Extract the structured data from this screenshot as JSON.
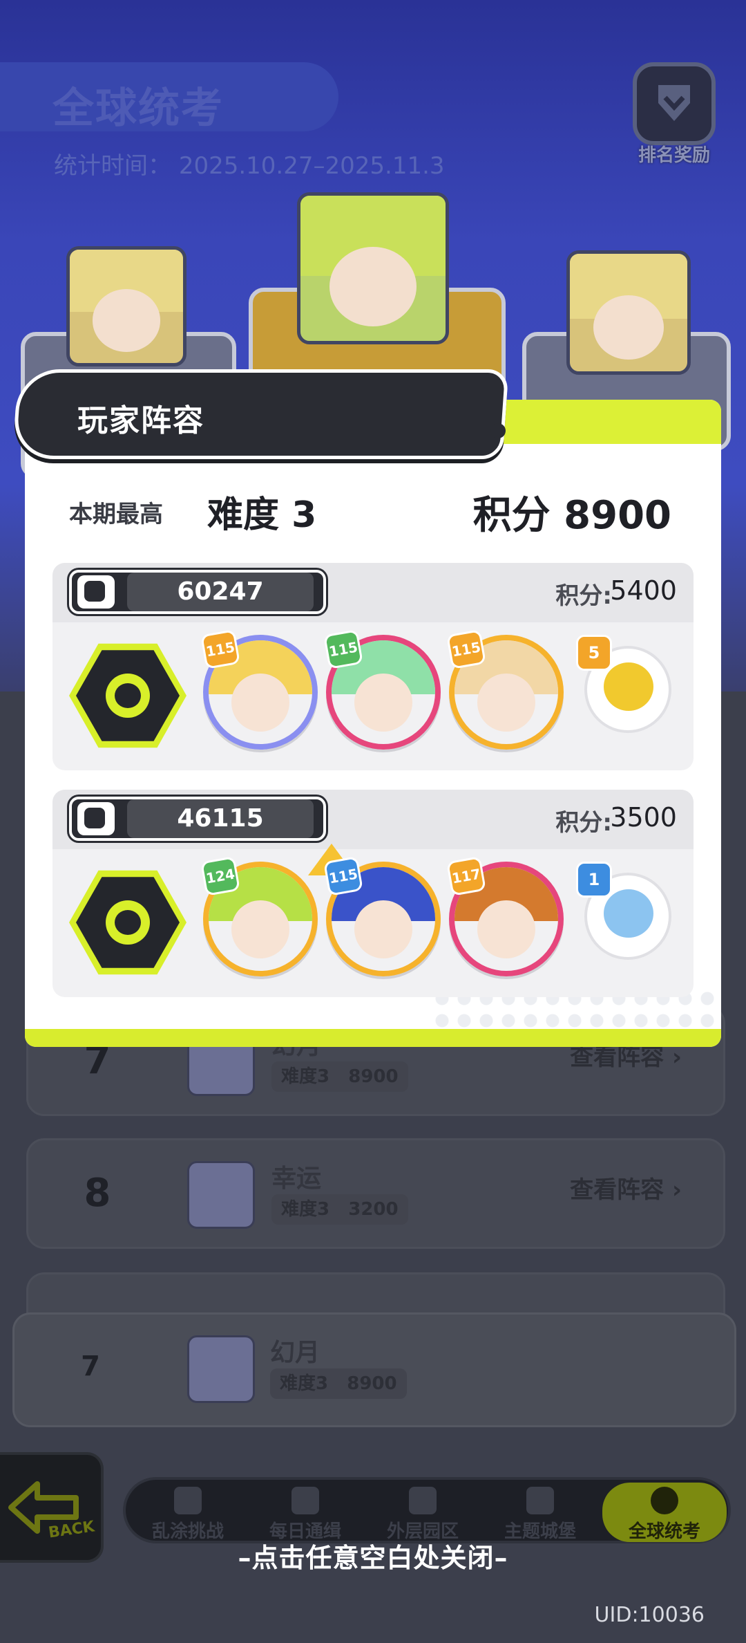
{
  "background": {
    "title": "全球统考",
    "stat_time_label": "统计时间：",
    "stat_time_value": "2025.10.27–2025.11.3",
    "reward_label": "排名奖励",
    "rows": [
      {
        "rank": "7",
        "name": "幻月",
        "difficulty": "难度3",
        "score": "8900",
        "view": "查看阵容"
      },
      {
        "rank": "8",
        "name": "幸运",
        "difficulty": "难度3",
        "score": "3200",
        "view": "查看阵容"
      }
    ],
    "self_row": {
      "rank": "7",
      "name": "幻月",
      "difficulty": "难度3",
      "score": "8900"
    }
  },
  "nav": {
    "items": [
      "乱涂挑战",
      "每日通缉",
      "外层园区",
      "主题城堡",
      "全球统考"
    ],
    "active": "全球统考",
    "back_label": "BACK"
  },
  "modal": {
    "title": "玩家阵容",
    "best_label": "本期最高",
    "difficulty": "难度 3",
    "score": "积分 8900",
    "teams": [
      {
        "power": "60247",
        "score_label": "积分:",
        "score_value": "5400",
        "heroes": [
          {
            "level": "115",
            "ring_color": "#8a8ff0",
            "hair_color": "#f4d25a"
          },
          {
            "level": "115",
            "ring_color": "#e6467c",
            "hair_color": "#8fe0a8"
          },
          {
            "level": "115",
            "ring_color": "#f6b22c",
            "hair_color": "#f2d7a6"
          }
        ],
        "pet": {
          "level": "5",
          "level_color": "#f3a529",
          "body_color": "#f1c92e"
        }
      },
      {
        "power": "46115",
        "score_label": "积分:",
        "score_value": "3500",
        "heroes": [
          {
            "level": "124",
            "ring_color": "#f6b22c",
            "hair_color": "#b6e046"
          },
          {
            "level": "115",
            "ring_color": "#f6b22c",
            "hair_color": "#3a53c9"
          },
          {
            "level": "117",
            "ring_color": "#e6467c",
            "hair_color": "#d47a2e"
          }
        ],
        "pet": {
          "level": "1",
          "level_color": "#3d8de0",
          "body_color": "#8cc4f0"
        }
      }
    ]
  },
  "close_hint": "–点击任意空白处关闭–",
  "uid": "UID:10036"
}
